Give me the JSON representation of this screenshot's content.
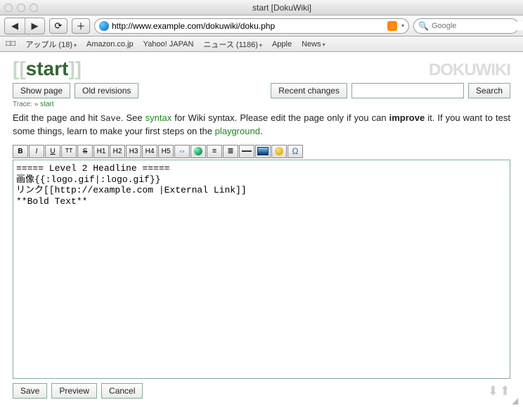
{
  "window": {
    "title": "start [DokuWiki]"
  },
  "browser": {
    "url": "http://www.example.com/dokuwiki/doku.php",
    "search_placeholder": "Google",
    "bookmarks": [
      "アップル (18)",
      "Amazon.co.jp",
      "Yahoo! JAPAN",
      "ニュース (1186)",
      "Apple",
      "News"
    ]
  },
  "wiki": {
    "title_brackets_open": "[[",
    "title": "start",
    "title_brackets_close": "]]",
    "logo_text": "DOKUWIKI",
    "buttons": {
      "show_page": "Show page",
      "old_revisions": "Old revisions",
      "recent_changes": "Recent changes",
      "search": "Search",
      "save": "Save",
      "preview": "Preview",
      "cancel": "Cancel"
    },
    "trace": {
      "label": "Trace:",
      "sep": "»",
      "link": "start"
    },
    "instructions": {
      "p1a": "Edit the page and hit ",
      "p1_mono": "Save",
      "p1b": ". See ",
      "p1_link1": "syntax",
      "p1c": " for Wiki syntax. Please edit the page only if you can ",
      "p1_strong": "improve",
      "p1d": " it. If you want to test some things, learn to make your first steps on the ",
      "p1_link2": "playground",
      "p1e": "."
    },
    "toolbar_labels": {
      "b": "B",
      "i": "I",
      "u": "U",
      "tt": "TT",
      "s": "S",
      "h1": "H1",
      "h2": "H2",
      "h3": "H3",
      "h4": "H4",
      "h5": "H5",
      "omega": "Ω"
    },
    "editor_content": "===== Level 2 Headline =====\n画像{{:logo.gif|:logo.gif}}\nリンク[[http://example.com |External Link]]\n**Bold Text**"
  }
}
